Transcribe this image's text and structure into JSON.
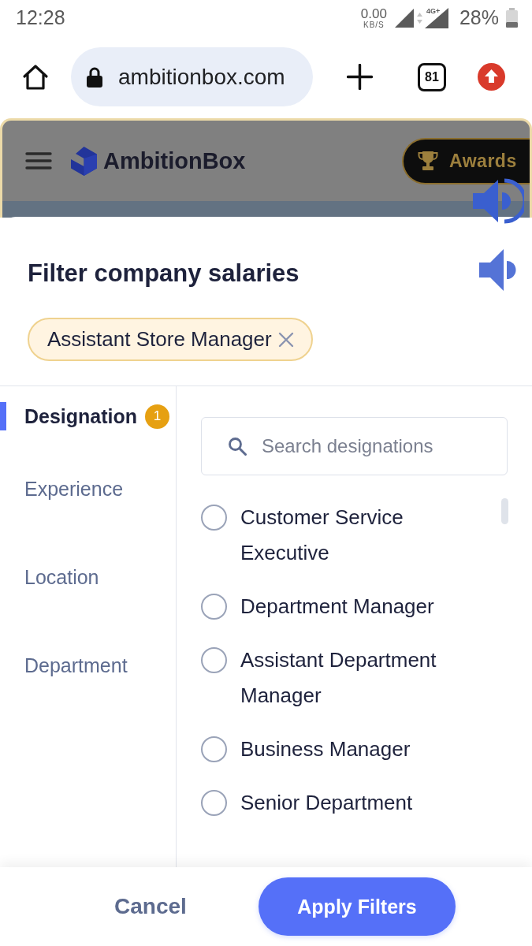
{
  "status_bar": {
    "time": "12:28",
    "net_speed": "0.00",
    "net_unit": "KB/S",
    "network_type": "4G+",
    "battery": "28%"
  },
  "browser_toolbar": {
    "url": "ambitionbox.com",
    "tab_count": "81"
  },
  "site_header": {
    "logo_text": "AmbitionBox",
    "awards_label": "Awards"
  },
  "filter_sheet": {
    "title": "Filter company salaries",
    "applied_filters": [
      {
        "label": "Assistant Store Manager"
      }
    ],
    "categories": [
      {
        "label": "Designation",
        "selected": true,
        "badge": "1"
      },
      {
        "label": "Experience",
        "selected": false
      },
      {
        "label": "Location",
        "selected": false
      },
      {
        "label": "Department",
        "selected": false
      }
    ],
    "search": {
      "placeholder": "Search designations"
    },
    "options": [
      {
        "label": "Customer Service Executive",
        "selected": false
      },
      {
        "label": "Department Manager",
        "selected": false
      },
      {
        "label": "Assistant Department Manager",
        "selected": false
      },
      {
        "label": "Business Manager",
        "selected": false
      },
      {
        "label": "Senior Department",
        "selected": false
      }
    ]
  },
  "footer": {
    "cancel": "Cancel",
    "apply": "Apply Filters"
  }
}
